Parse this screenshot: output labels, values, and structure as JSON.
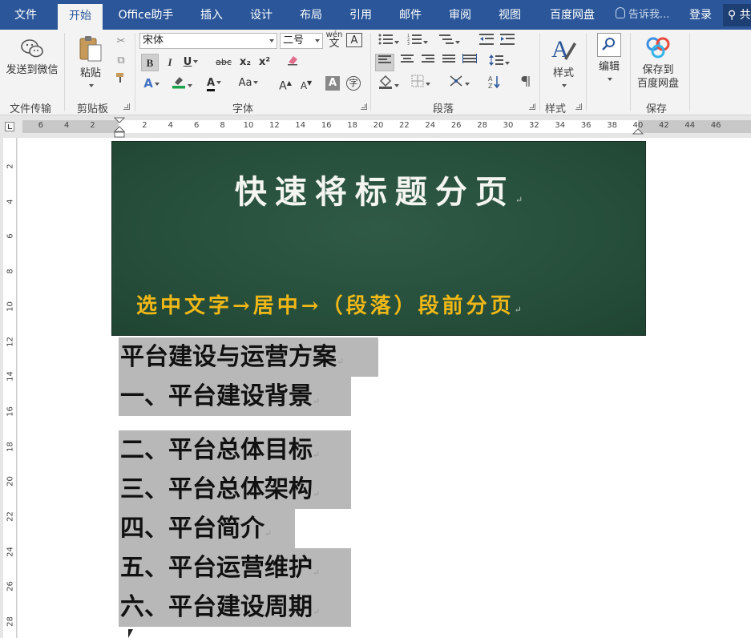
{
  "tabs": [
    {
      "label": "文件",
      "active": false
    },
    {
      "label": "开始",
      "active": true
    },
    {
      "label": "Office助手",
      "active": false
    },
    {
      "label": "插入",
      "active": false
    },
    {
      "label": "设计",
      "active": false
    },
    {
      "label": "布局",
      "active": false
    },
    {
      "label": "引用",
      "active": false
    },
    {
      "label": "邮件",
      "active": false
    },
    {
      "label": "审阅",
      "active": false
    },
    {
      "label": "视图",
      "active": false
    },
    {
      "label": "百度网盘",
      "active": false
    }
  ],
  "tell_me": "告诉我...",
  "login": "登录",
  "share": "共享",
  "ribbon": {
    "wechat": {
      "button": "发送到微信",
      "group": "文件传输"
    },
    "clipboard": {
      "paste": "粘贴",
      "group": "剪贴板"
    },
    "font": {
      "name": "宋体",
      "size": "二号",
      "group": "字体",
      "bold": "B",
      "italic": "I",
      "underline": "U",
      "strike": "abc",
      "subscript": "x₂",
      "superscript": "x²",
      "grow": "A",
      "shrink": "A",
      "case": "Aa",
      "phonetic_top": "wén",
      "phonetic_bottom": "文",
      "border_char": "A",
      "shade_char": "A",
      "enclose_char": "字"
    },
    "paragraph": {
      "group": "段落"
    },
    "styles": {
      "button": "样式",
      "group": "样式"
    },
    "editing": {
      "button": "编辑"
    },
    "save": {
      "button_line1": "保存到",
      "button_line2": "百度网盘",
      "group": "保存"
    }
  },
  "ruler": {
    "numbers": [
      "6",
      "4",
      "2",
      "2",
      "4",
      "6",
      "8",
      "10",
      "12",
      "14",
      "16",
      "18",
      "20",
      "22",
      "24",
      "26",
      "28",
      "30",
      "32",
      "34",
      "36",
      "38",
      "40",
      "42",
      "44",
      "46"
    ],
    "vertical_numbers": [
      "2",
      "4",
      "6",
      "8",
      "10",
      "12",
      "14",
      "16",
      "18",
      "20",
      "22",
      "24",
      "26",
      "28"
    ]
  },
  "document": {
    "banner_title": "快速将标题分页",
    "banner_subtitle": "选中文字→居中→（段落）段前分页",
    "paragraph_mark": "↵",
    "lines": [
      "平台建设与运营方案",
      "一、平台建设背景",
      "二、平台总体目标",
      "三、平台总体架构",
      "四、平台简介",
      "五、平台运营维护",
      "六、平台建设周期"
    ]
  },
  "colors": {
    "titlebar": "#2b579a",
    "banner_bg": "#27503c",
    "banner_title": "#f4f4f0",
    "banner_subtitle": "#f0b817",
    "selection": "#b8b8b8"
  }
}
